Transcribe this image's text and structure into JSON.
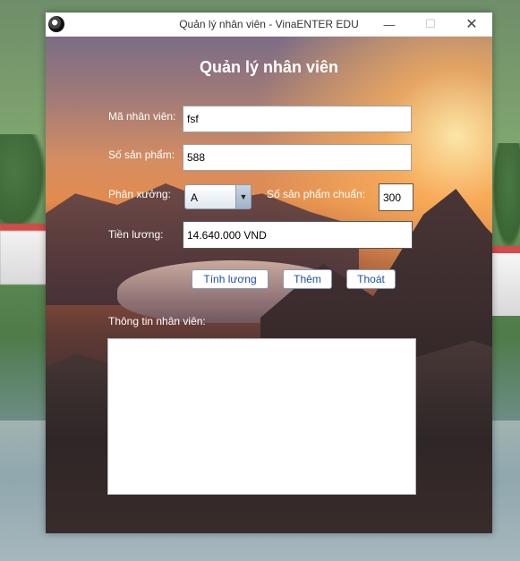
{
  "window": {
    "title": "Quản lý nhân viên - VinaENTER EDU",
    "buttons": {
      "minimize": "—",
      "maximize": "☐",
      "close": "✕"
    }
  },
  "form": {
    "heading": "Quản lý nhân viên",
    "employee_id": {
      "label": "Mã nhân viên:",
      "value": "fsf"
    },
    "product_count": {
      "label": "Số sản phẩm:",
      "value": "588"
    },
    "workshop": {
      "label": "Phân xưởng:",
      "selected": "A"
    },
    "standard_products": {
      "label": "Số sản phẩm chuẩn:",
      "value": "300"
    },
    "salary": {
      "label": "Tiền lương:",
      "value": "14.640.000 VND"
    },
    "actions": {
      "calculate": "Tính lương",
      "add": "Thêm",
      "exit": "Thoát"
    },
    "info": {
      "label": "Thông tin nhân viên:",
      "value": ""
    }
  }
}
